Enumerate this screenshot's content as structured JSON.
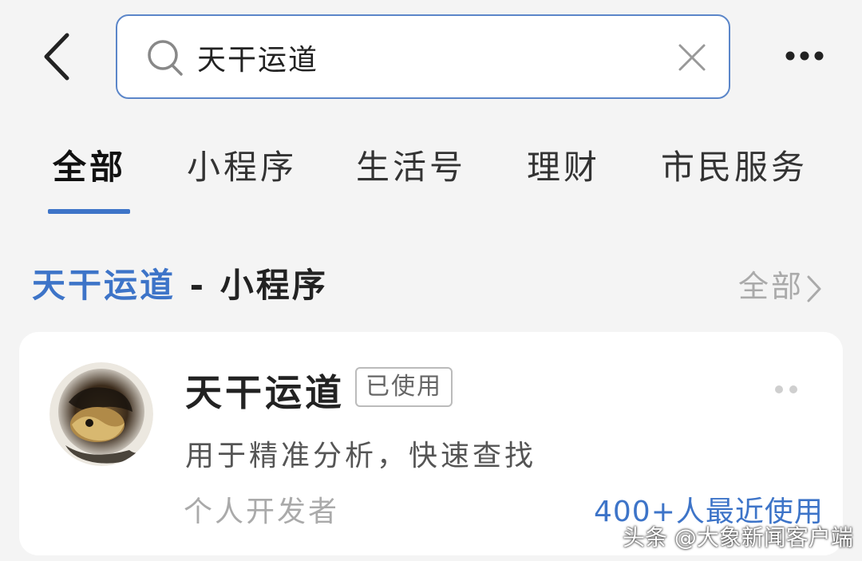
{
  "search": {
    "query": "天干运道"
  },
  "tabs": [
    {
      "label": "全部"
    },
    {
      "label": "小程序"
    },
    {
      "label": "生活号"
    },
    {
      "label": "理财"
    },
    {
      "label": "市民服务"
    }
  ],
  "section": {
    "keyword": "天干运道",
    "separator": " - ",
    "category": "小程序",
    "more_label": "全部"
  },
  "result": {
    "name": "天干运道",
    "badge": "已使用",
    "description": "用于精准分析，快速查找",
    "developer": "个人开发者",
    "users": "400+人最近使用"
  },
  "watermark": "头条 @大象新闻客户端",
  "colors": {
    "accent": "#3d74c8",
    "background": "#f4f4f4",
    "search_border": "#5b86c9"
  },
  "icons": {
    "back": "chevron-left-icon",
    "search": "search-icon",
    "clear": "close-icon",
    "more": "more-horizontal-icon",
    "section_more": "chevron-right-icon",
    "card_menu": "more-dots-icon"
  }
}
